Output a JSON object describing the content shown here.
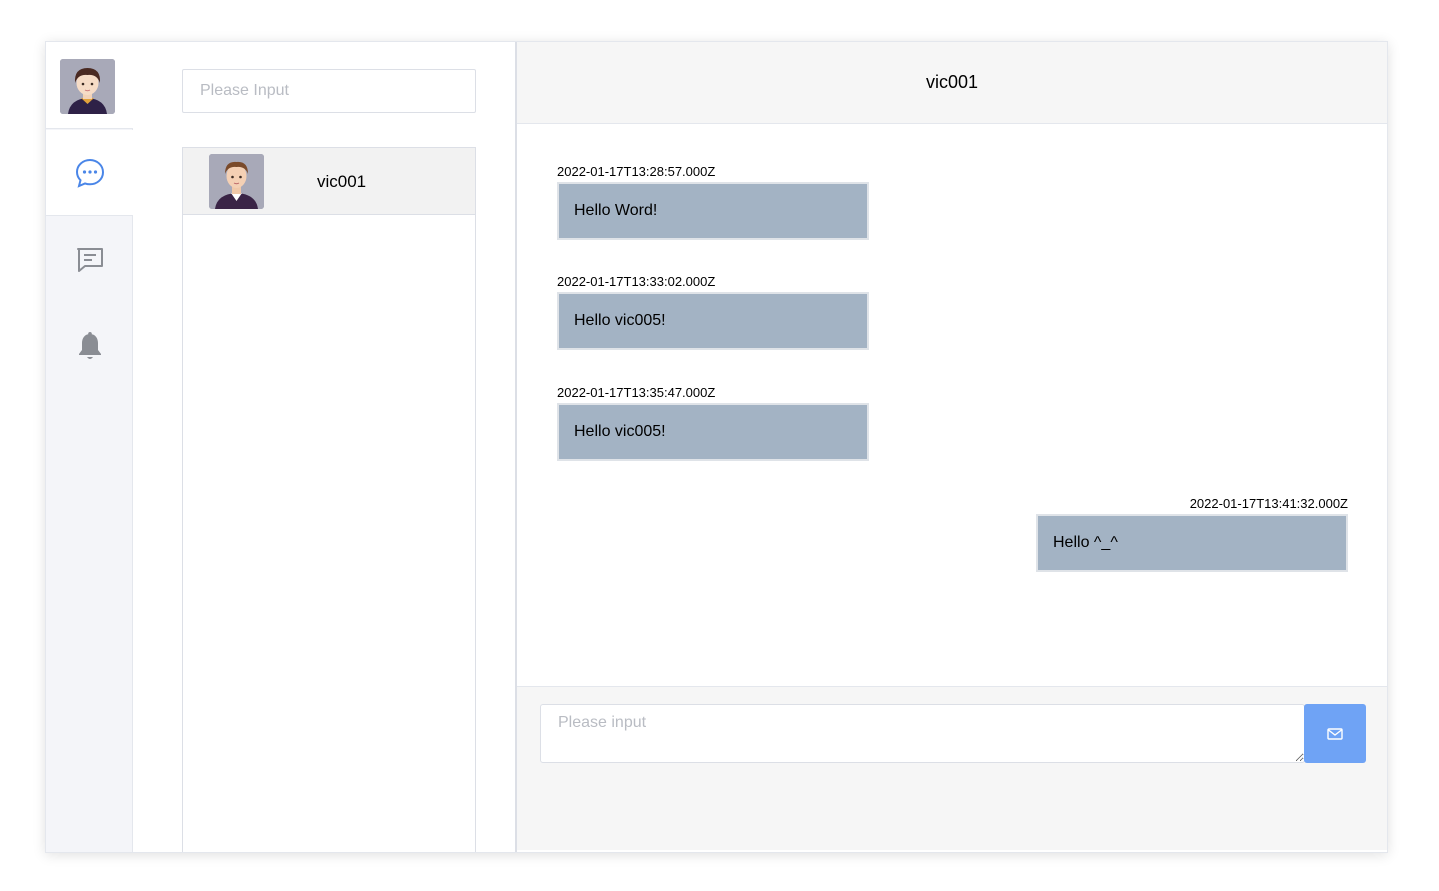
{
  "user": {
    "avatar": "user-avatar"
  },
  "nav": {
    "items": [
      {
        "icon": "chat-bubble-icon",
        "active": true
      },
      {
        "icon": "message-icon",
        "active": false
      },
      {
        "icon": "bell-icon",
        "active": false
      }
    ],
    "accent": "#4a86e8"
  },
  "contacts": {
    "search_placeholder": "Please Input",
    "items": [
      {
        "name": "vic001",
        "avatar": "contact-avatar"
      }
    ]
  },
  "chat": {
    "title": "vic001",
    "messages": [
      {
        "time": "2022-01-17T13:28:57.000Z",
        "text": "Hello Word!",
        "side": "left"
      },
      {
        "time": "2022-01-17T13:33:02.000Z",
        "text": "Hello vic005!",
        "side": "left"
      },
      {
        "time": "2022-01-17T13:35:47.000Z",
        "text": "Hello vic005!",
        "side": "left"
      },
      {
        "time": "2022-01-17T13:41:32.000Z",
        "text": "Hello ^_^",
        "side": "right"
      }
    ],
    "input_placeholder": "Please input",
    "send_icon": "envelope-icon",
    "bubble_color": "#a3b3c4",
    "send_color": "#6fa3f5"
  }
}
